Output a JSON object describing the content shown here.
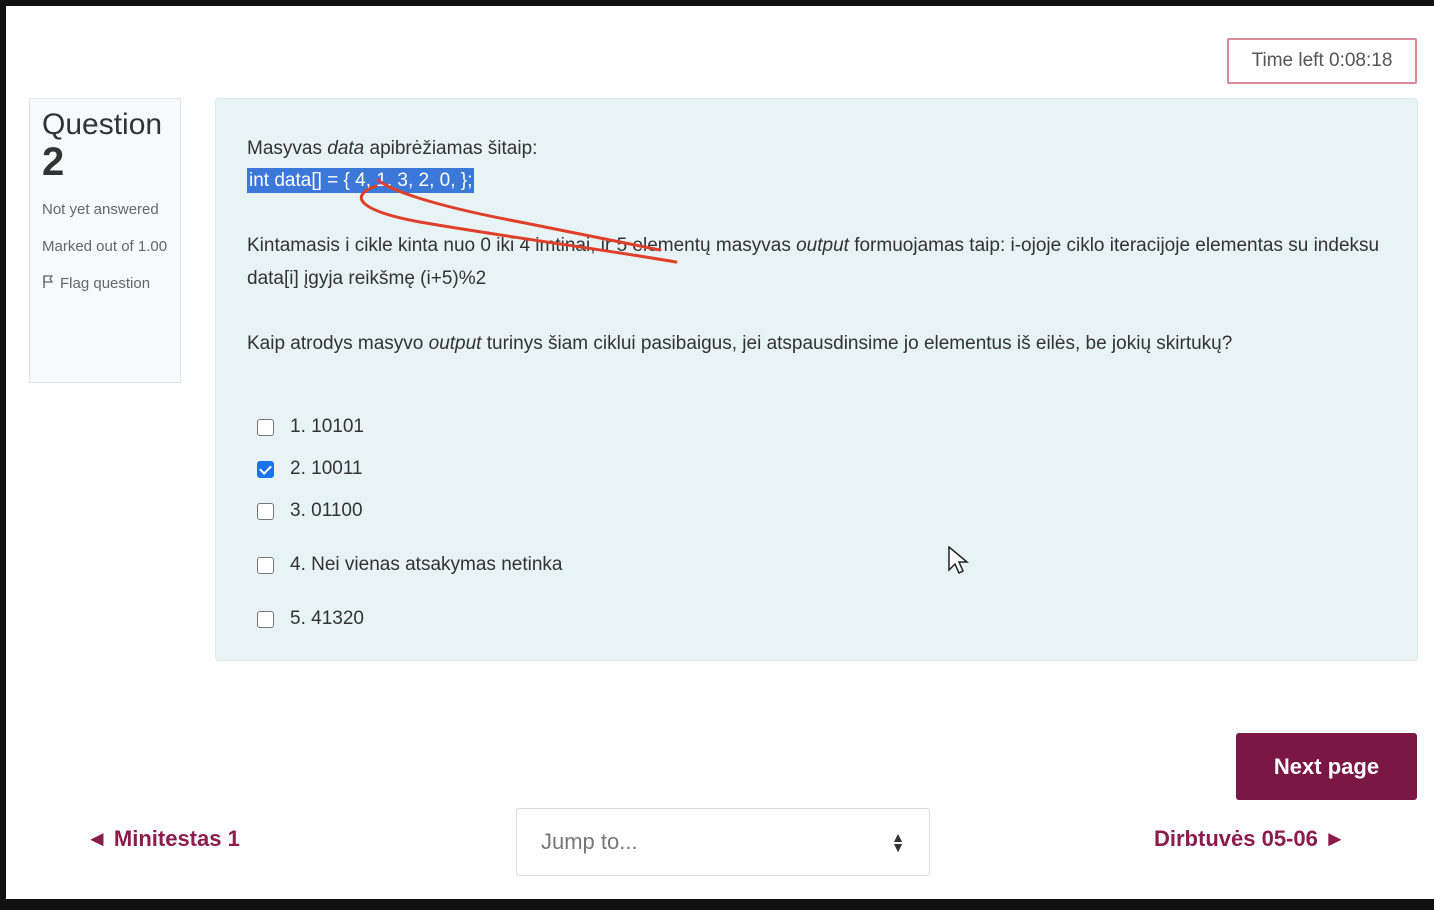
{
  "timer": "Time left 0:08:18",
  "question_info": {
    "word": "Question",
    "number": "2",
    "status": "Not yet answered",
    "marked": "Marked out of 1.00",
    "flag": "Flag question",
    "flag_icon": "flag-icon"
  },
  "question": {
    "line1_prefix": "Masyvas ",
    "line1_em": "data",
    "line1_suffix": " apibrėžiamas šitaip:",
    "code": "int data[] = { 4, 1, 3, 2, 0, };",
    "para1_a": "Kintamasis i cikle kinta nuo 0 iki 4 imtinai, ir 5 elementų masyvas ",
    "para1_em": "output",
    "para1_b": " formuojamas taip: i-ojoje ciklo iteracijoje elementas su indeksu data[i] įgyja reikšmę (i+5)%2",
    "para2_a": "Kaip atrodys masyvo ",
    "para2_em": "output",
    "para2_b": " turinys šiam ciklui pasibaigus, jei atspausdinsime jo elementus iš eilės, be jokių skirtukų?"
  },
  "options": [
    {
      "label": "1. 10101",
      "checked": false
    },
    {
      "label": "2. 10011",
      "checked": true
    },
    {
      "label": "3. 01100",
      "checked": false
    },
    {
      "label": "4. Nei vienas atsakymas netinka",
      "checked": false
    },
    {
      "label": "5. 41320",
      "checked": false
    }
  ],
  "annotation_color": "#e0402a",
  "nav": {
    "next_button": "Next page",
    "prev_link": "◄ Minitestas 1",
    "jump_placeholder": "Jump to...",
    "next_link": "Dirbtuvės 05-06 ►"
  },
  "colors": {
    "accent": "#7a1745",
    "link": "#8b1c4c",
    "card_bg": "#e7f3f5",
    "selection": "#3b78d8",
    "timer_border": "#d98a94"
  }
}
